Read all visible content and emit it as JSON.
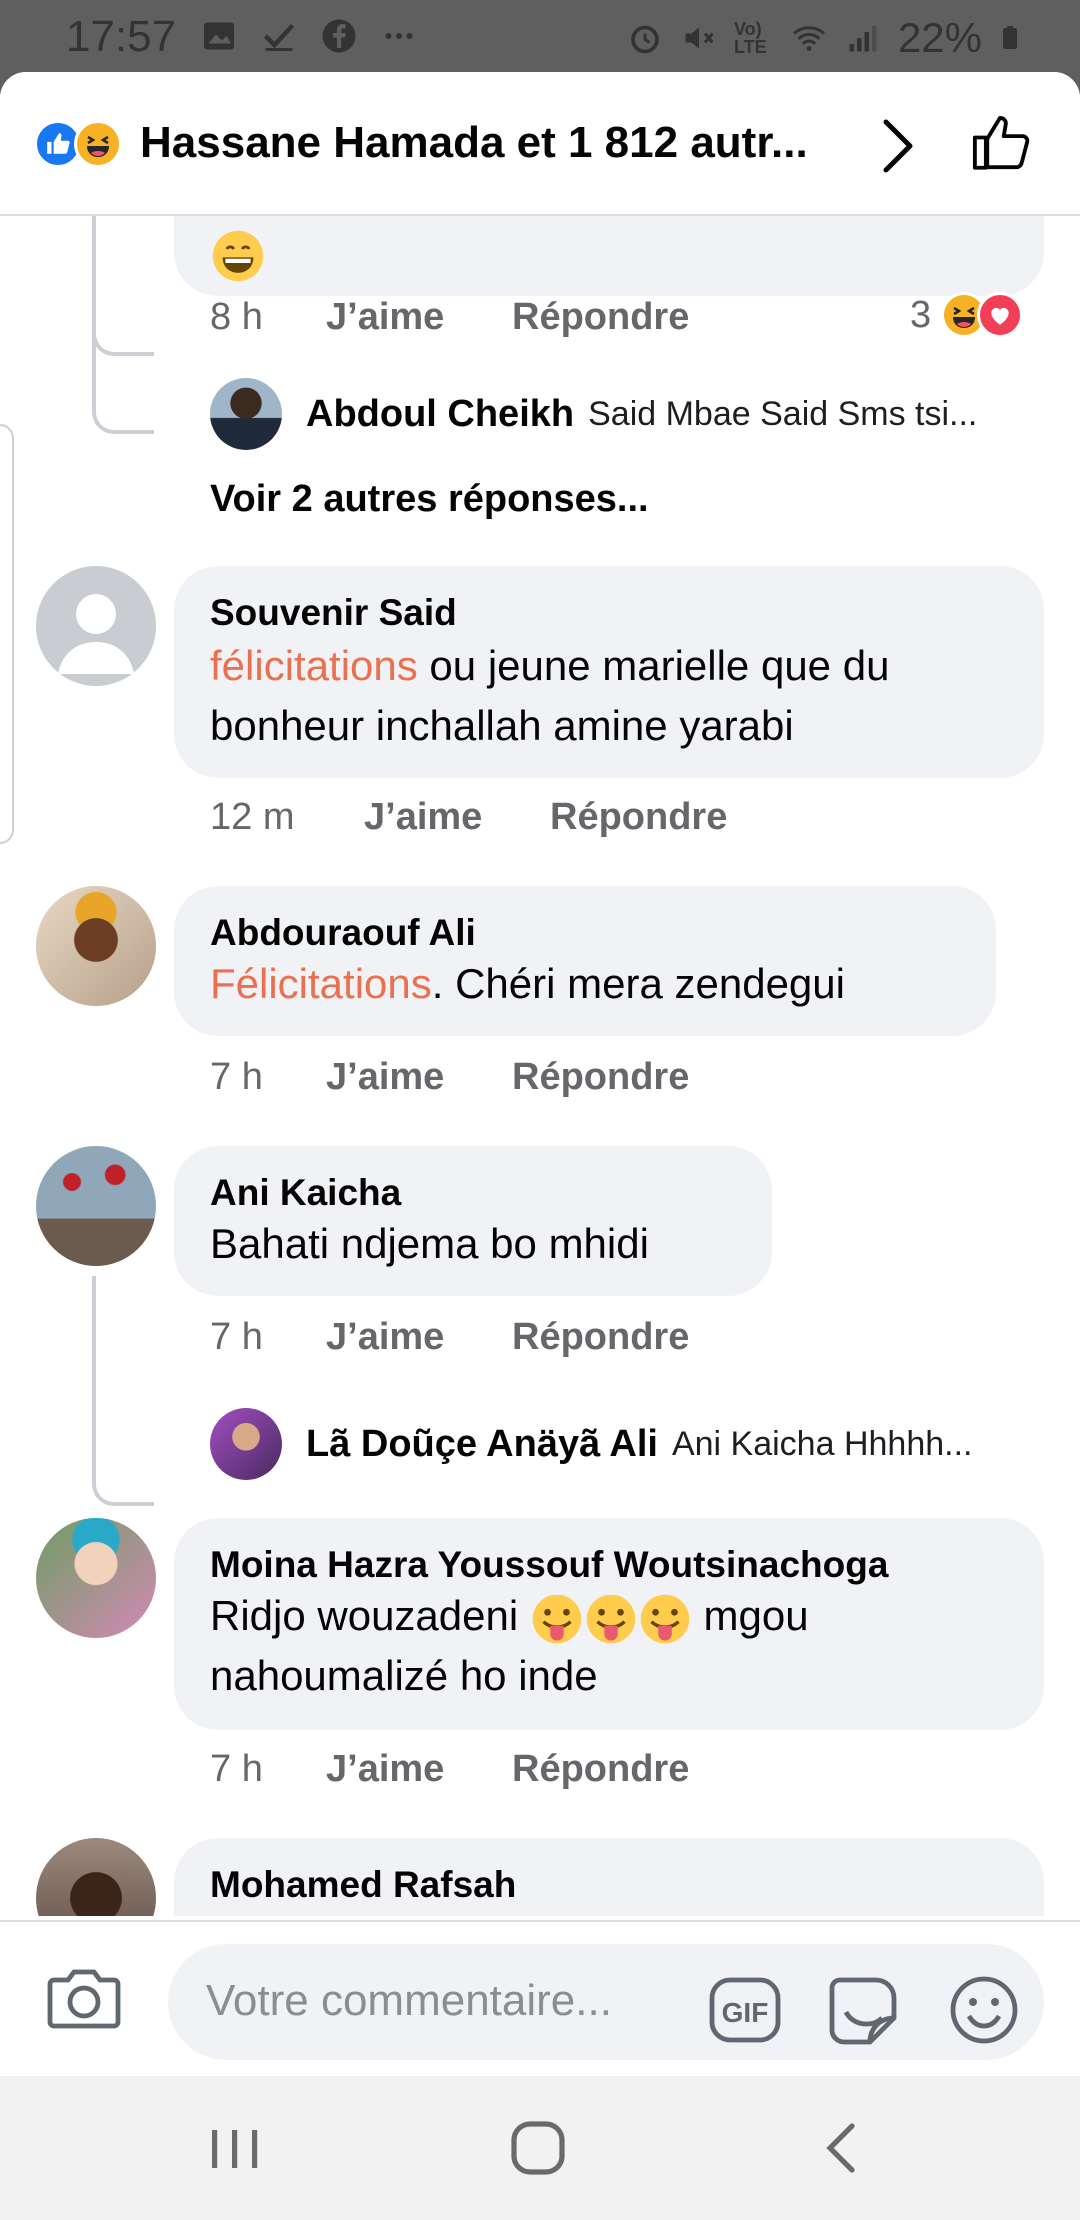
{
  "status_bar": {
    "time": "17:57",
    "battery": "22%",
    "network": "Vo) LTE",
    "icons_left": [
      "gallery-icon",
      "check-icon",
      "facebook-icon",
      "more-icon"
    ],
    "icons_right": [
      "alarm-icon",
      "mute-icon",
      "signal-lte-icon",
      "wifi-icon",
      "cell-signal-icon",
      "battery-icon"
    ]
  },
  "header": {
    "reactions": [
      "like",
      "haha"
    ],
    "title": "Hassane Hamada et 1 812 autr..."
  },
  "comments": [
    {
      "partial": true,
      "text_emoji": "😄",
      "time": "8 h",
      "like_label": "J’aime",
      "reply_label": "Répondre",
      "reaction_count": "3",
      "reaction_icons": [
        "haha",
        "love"
      ],
      "reply_preview": {
        "name": "Abdoul Cheikh",
        "text": "Said Mbae Said Sms tsi..."
      },
      "more_replies": "Voir 2 autres réponses..."
    },
    {
      "author": "Souvenir Said",
      "highlight": "félicitations",
      "text_line1": " ou jeune marielle que du",
      "text_line2": "bonheur inchallah amine yarabi",
      "time": "12 m",
      "like_label": "J’aime",
      "reply_label": "Répondre"
    },
    {
      "author": "Abdouraouf Ali",
      "highlight": "Félicitations",
      "text_line1": ". Chéri mera zendegui",
      "time": "7 h",
      "like_label": "J’aime",
      "reply_label": "Répondre"
    },
    {
      "author": "Ani Kaicha",
      "text_line1": "Bahati ndjema bo mhidi",
      "time": "7 h",
      "like_label": "J’aime",
      "reply_label": "Répondre",
      "reply_preview": {
        "name": "Lã Doũçe Anäyã Ali",
        "text": "Ani Kaicha Hhhhh..."
      }
    },
    {
      "author": "Moina Hazra Youssouf Woutsinachoga",
      "text_line1_a": "Ridjo wouzadeni ",
      "text_line1_b": " mgou",
      "text_line2": "nahoumalizé ho inde",
      "time": "7 h",
      "like_label": "J’aime",
      "reply_label": "Répondre"
    },
    {
      "author": "Mohamed Rafsah"
    }
  ],
  "composer": {
    "placeholder": "Votre commentaire...",
    "gif_label": "GIF"
  },
  "colors": {
    "accent_blue": "#1877f2",
    "highlight_orange": "#e9714f",
    "bubble": "#f0f2f5",
    "meta_gray": "#65676b"
  }
}
